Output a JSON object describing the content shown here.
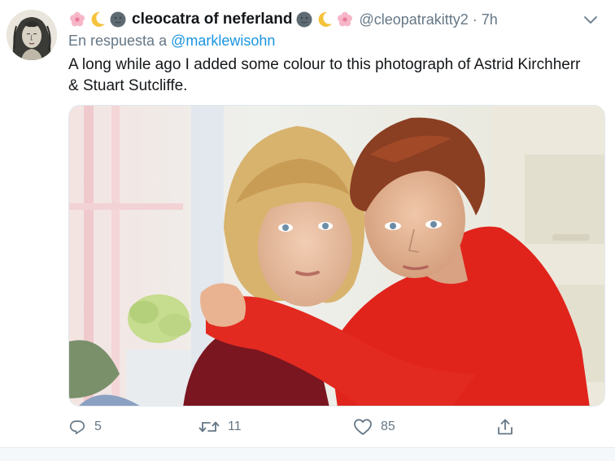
{
  "tweet": {
    "display_name": "cleocatra of neferland",
    "handle": "@cleopatrakitty2",
    "separator": "·",
    "time": "7h",
    "reply_prefix": "En respuesta a",
    "reply_mention": "@marklewisohn",
    "text": "A long while ago I added some colour to this photograph of Astrid Kirchherr & Stuart Sutcliffe.",
    "name_emojis_left": [
      "cherry-blossom-icon",
      "crescent-moon-icon",
      "new-moon-face-icon"
    ],
    "name_emojis_right": [
      "new-moon-face-icon",
      "crescent-moon-icon",
      "cherry-blossom-icon"
    ]
  },
  "actions": {
    "reply_count": "5",
    "retweet_count": "11",
    "like_count": "85",
    "share_count": ""
  },
  "colors": {
    "link": "#1b95e0",
    "secondary_text": "#657786",
    "primary_text": "#14171a",
    "sweater_red": "#e0241c",
    "sweater_dark": "#7a1620"
  }
}
